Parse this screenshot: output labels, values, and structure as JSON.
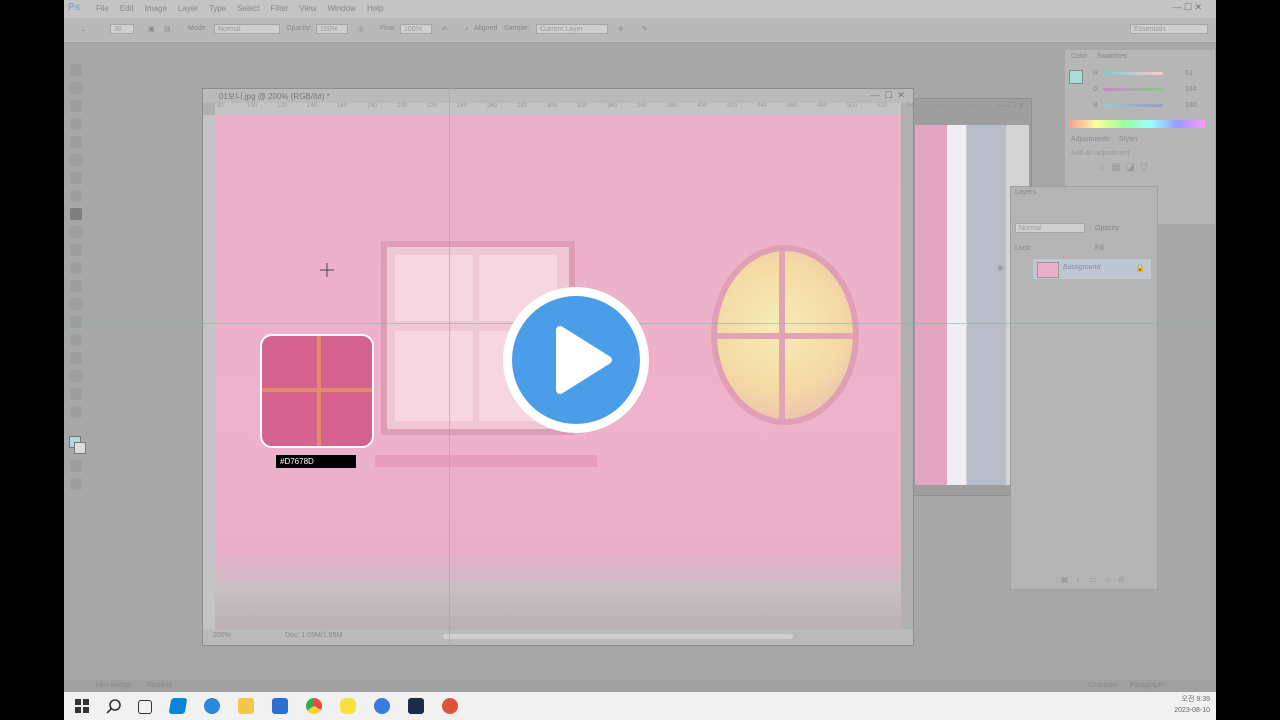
{
  "app": {
    "logo": "Ps",
    "menu": [
      "File",
      "Edit",
      "Image",
      "Layer",
      "Type",
      "Select",
      "Filter",
      "View",
      "Window",
      "Help"
    ],
    "window_controls": "— ☐ ✕"
  },
  "options_bar": {
    "brush_size": "30",
    "mode_label": "Mode:",
    "mode_value": "Normal",
    "opacity_label": "Opacity:",
    "opacity_value": "100%",
    "flow_label": "Flow:",
    "flow_value": "100%",
    "aligned_label": "Aligned",
    "sample_label": "Sample:",
    "sample_value": "Current Layer",
    "workspace": "Essentials"
  },
  "document": {
    "title": "01보니.jpg @ 200% (RGB/8#) *",
    "ruler_ticks": [
      "80",
      "100",
      "120",
      "140",
      "160",
      "180",
      "200",
      "220",
      "240",
      "260",
      "280",
      "300",
      "320",
      "340",
      "360",
      "380",
      "400",
      "420",
      "440",
      "460",
      "480",
      "500",
      "520",
      "540",
      "560",
      "580",
      "600"
    ],
    "zoom": "200%",
    "doc_info": "Doc: 1.05M/1.05M"
  },
  "sample": {
    "hex": "#D7678D",
    "color": "#D5628D"
  },
  "color_panel": {
    "tab_color": "Color",
    "tab_swatches": "Swatches",
    "r_label": "R",
    "g_label": "G",
    "b_label": "B",
    "r_value": "61",
    "g_value": "184",
    "b_value": "180",
    "fg_color": "#A8DCD6"
  },
  "adjustments": {
    "tab_adjustments": "Adjustments",
    "tab_styles": "Styles",
    "heading": "Add an adjustment"
  },
  "layers": {
    "title": "Layers",
    "blend": "Normal",
    "opacity_label": "Opacity:",
    "lock_label": "Lock:",
    "fill_label": "Fill:",
    "layer_name": "Background"
  },
  "mini_bridge": {
    "tab1": "Mini Bridge",
    "tab2": "Timeline",
    "right_tab1": "Character",
    "right_tab2": "Paragraph"
  },
  "taskbar": {
    "time": "오전 9:39",
    "date": "2023-08-10"
  },
  "accent": "#4A9EE8"
}
